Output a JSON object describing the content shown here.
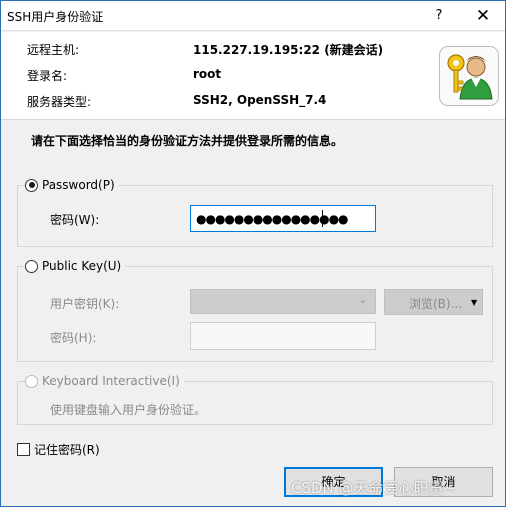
{
  "window": {
    "title": "SSH用户身份验证",
    "help_glyph": "?",
    "close_glyph": "✕"
  },
  "info": {
    "remote_host_label": "远程主机:",
    "remote_host_value": "115.227.19.195:22 (新建会话)",
    "login_label": "登录名:",
    "login_value": "root",
    "server_type_label": "服务器类型:",
    "server_type_value": "SSH2, OpenSSH_7.4",
    "icon": "user-key-icon"
  },
  "instruction": "请在下面选择恰当的身份验证方法并提供登录所需的信息。",
  "password_method": {
    "label": "Password(P)",
    "selected": true,
    "field_label": "密码(W):",
    "value_masked": "●●●●●●●●●●●●●●●●"
  },
  "publickey_method": {
    "label": "Public Key(U)",
    "selected": false,
    "user_key_label": "用户密钥(K):",
    "browse_label": "浏览(B)...",
    "passphrase_label": "密码(H):"
  },
  "keyboard_method": {
    "label": "Keyboard Interactive(I)",
    "description": "使用键盘输入用户身份验证。"
  },
  "remember_password": {
    "label": "记住密码(R)",
    "checked": false
  },
  "buttons": {
    "ok": "确定",
    "cancel": "取消"
  },
  "watermark": "CSDN @天命爱心职责~",
  "colors": {
    "accent": "#0078d7",
    "border": "#2b6fbd"
  }
}
